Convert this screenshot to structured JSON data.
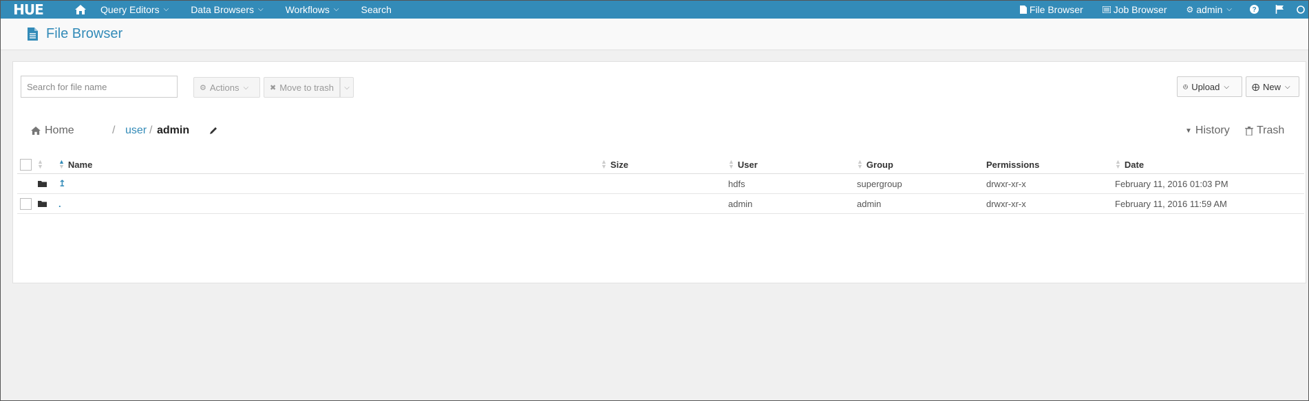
{
  "app": {
    "logo_text": "HUE",
    "accent": "#338bb8"
  },
  "topnav": {
    "items": [
      {
        "label": "Query Editors",
        "has_dropdown": true
      },
      {
        "label": "Data Browsers",
        "has_dropdown": true
      },
      {
        "label": "Workflows",
        "has_dropdown": true
      },
      {
        "label": "Search",
        "has_dropdown": false
      }
    ],
    "right": {
      "file_browser": "File Browser",
      "job_browser": "Job Browser",
      "user": "admin"
    }
  },
  "page": {
    "title": "File Browser"
  },
  "toolbar": {
    "search_placeholder": "Search for file name",
    "actions_label": "Actions",
    "move_to_trash_label": "Move to trash",
    "upload_label": "Upload",
    "new_label": "New"
  },
  "breadcrumb": {
    "home": "Home",
    "sep": "/",
    "user": "user",
    "current": "admin"
  },
  "links": {
    "history": "History",
    "trash": "Trash"
  },
  "table": {
    "columns": [
      "Name",
      "Size",
      "User",
      "Group",
      "Permissions",
      "Date"
    ],
    "rows": [
      {
        "name": "↥",
        "size": "",
        "user": "hdfs",
        "group": "supergroup",
        "permissions": "drwxr-xr-x",
        "date": "February 11, 2016 01:03 PM",
        "selectable": false
      },
      {
        "name": ".",
        "size": "",
        "user": "admin",
        "group": "admin",
        "permissions": "drwxr-xr-x",
        "date": "February 11, 2016 11:59 AM",
        "selectable": true
      }
    ]
  }
}
